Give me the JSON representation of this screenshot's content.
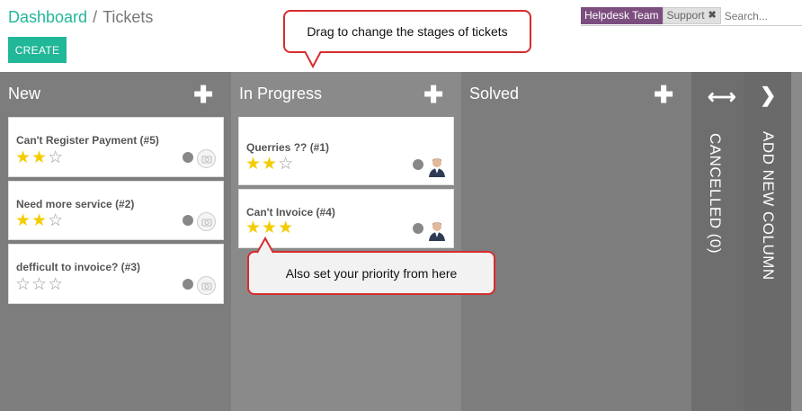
{
  "breadcrumb": {
    "parent": "Dashboard",
    "current": "Tickets",
    "separator": "/"
  },
  "toolbar": {
    "create_label": "CREATE"
  },
  "search": {
    "facet_label": "Helpdesk Team",
    "facet_value": "Support",
    "facet_close": "✖",
    "placeholder": "Search..."
  },
  "columns": [
    {
      "title": "New",
      "add_icon": "plus-icon"
    },
    {
      "title": "In Progress",
      "add_icon": "plus-icon"
    },
    {
      "title": "Solved",
      "add_icon": "plus-icon"
    },
    {
      "title": "CANCELLED (0)",
      "icon": "arrows-horizontal-icon"
    },
    {
      "title": "ADD NEW COLUMN",
      "icon": "chevron-right-icon"
    }
  ],
  "cards": {
    "new": [
      {
        "title": "Can't Register Payment (#5)",
        "priority": 2,
        "max": 3
      },
      {
        "title": "Need more service (#2)",
        "priority": 2,
        "max": 3
      },
      {
        "title": "defficult to invoice? (#3)",
        "priority": 0,
        "max": 3
      }
    ],
    "in_progress": [
      {
        "title": "Querries ?? (#1)",
        "priority": 2,
        "max": 3
      },
      {
        "title": "Can't Invoice (#4)",
        "priority": 3,
        "max": 3
      }
    ]
  },
  "callouts": {
    "top": "Drag to change the stages of tickets",
    "bottom": "Also set your priority from here"
  },
  "colors": {
    "accent": "#21b799",
    "facet": "#7c4e7f",
    "star": "#f3cc00",
    "callout_border": "#d62c2c"
  },
  "plus_glyph": "✚",
  "arrows_glyph": "⟷",
  "chevron_glyph": "❯",
  "star_on": "★",
  "star_off": "☆"
}
